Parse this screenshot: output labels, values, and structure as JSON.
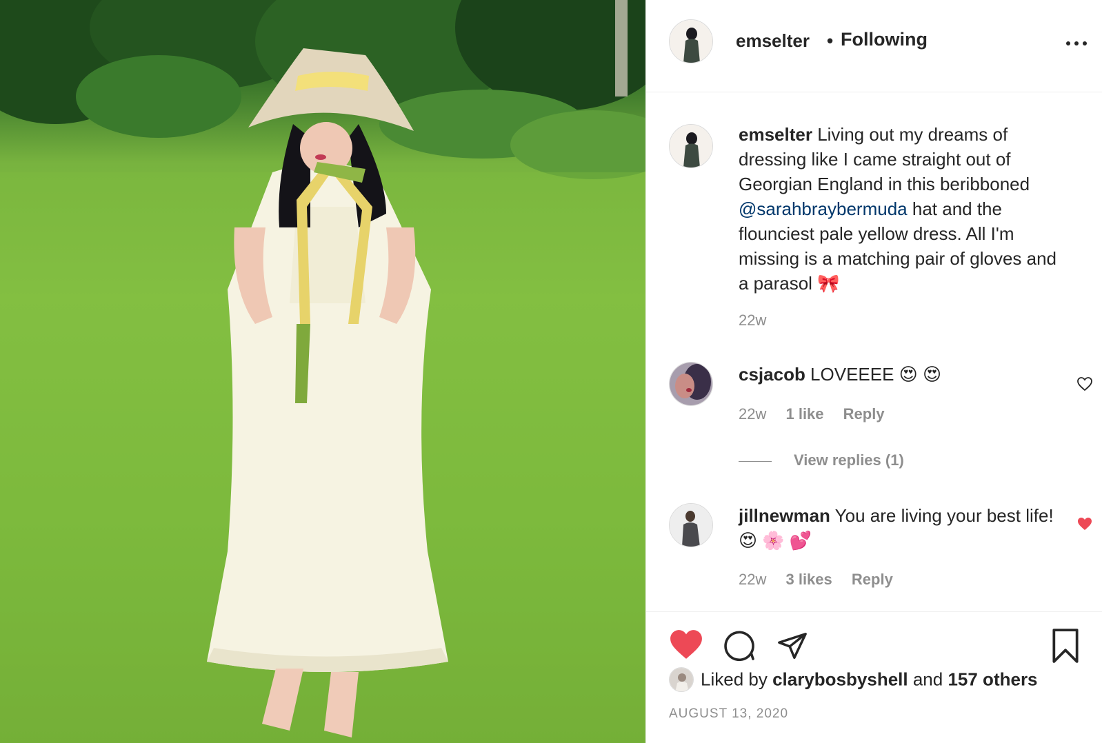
{
  "header": {
    "username": "emselter",
    "separator": "•",
    "follow_state": "Following",
    "more_icon": "more-horizontal-icon"
  },
  "caption": {
    "username": "emselter",
    "text_before": " Living out my dreams of dressing like I came straight out of Georgian England in this beribboned ",
    "mention": "@sarahbraybermuda",
    "text_after": " hat and the flounciest pale yellow dress. All I'm missing is a matching pair of gloves and a parasol 🎀",
    "time": "22w"
  },
  "comments": [
    {
      "username": "csjacob",
      "text": " LOVEEEE 😍 😍",
      "time": "22w",
      "likes": "1 like",
      "reply": "Reply",
      "liked": false,
      "view_replies": "View replies (1)"
    },
    {
      "username": "jillnewman",
      "text": " You are living your best life! 😍 🌸 💕",
      "time": "22w",
      "likes": "3 likes",
      "reply": "Reply",
      "liked": true
    }
  ],
  "actions": {
    "like_icon": "heart-filled-icon",
    "comment_icon": "comment-icon",
    "share_icon": "share-icon",
    "save_icon": "bookmark-icon",
    "like_color": "#ed4956"
  },
  "likes": {
    "prefix": "Liked by ",
    "user": "clarybosbyshell",
    "middle": " and ",
    "others": "157 others"
  },
  "post_date": "AUGUST 13, 2020",
  "colors": {
    "text": "#262626",
    "secondary": "#8e8e8e",
    "mention": "#00376b",
    "heart": "#ed4956",
    "border": "#efefef"
  }
}
